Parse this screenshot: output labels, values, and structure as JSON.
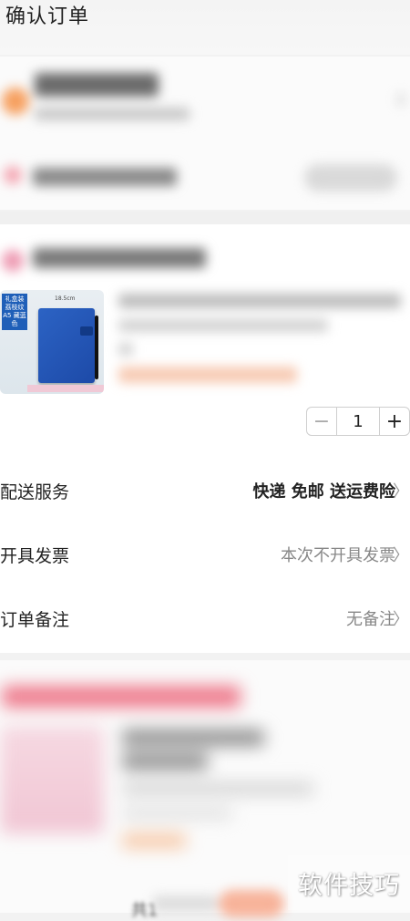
{
  "header": {
    "title": "确认订单"
  },
  "product": {
    "image_tag": "礼盒装 荔枝纹 A5 藏蓝色",
    "image_dim": "18.5cm",
    "quantity": "1",
    "minus_symbol": "−",
    "plus_symbol": "+"
  },
  "rows": [
    {
      "label": "配送服务",
      "value": "快递 免邮 送运费险"
    },
    {
      "label": "开具发票",
      "value": "本次不开具发票"
    },
    {
      "label": "订单备注",
      "value": "无备注"
    }
  ],
  "footer": {
    "total_prefix": "共1"
  },
  "watermark": "软件技巧",
  "icons": {
    "chevron": "chevron-right-icon"
  },
  "colors": {
    "accent": "#f6a060",
    "pink": "#ee7a8c"
  }
}
